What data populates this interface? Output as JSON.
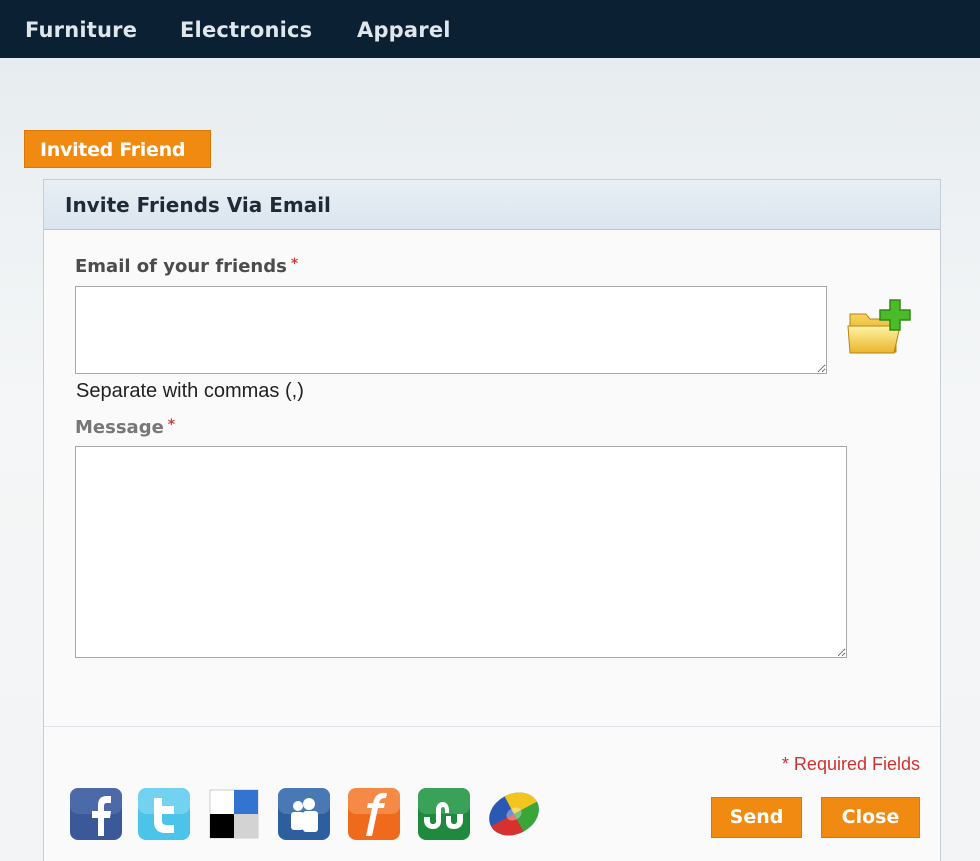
{
  "nav": {
    "items": [
      {
        "label": "Furniture"
      },
      {
        "label": "Electronics"
      },
      {
        "label": "Apparel"
      }
    ]
  },
  "tab": {
    "label": "Invited Friend"
  },
  "panel": {
    "title": "Invite Friends Via Email"
  },
  "form": {
    "email_label": "Email of your friends",
    "email_value": "",
    "email_hint": "Separate with commas (,)",
    "message_label": "Message",
    "message_value": "",
    "required_star": "*",
    "required_note": "* Required Fields"
  },
  "buttons": {
    "send": "Send",
    "close": "Close"
  },
  "social_icons": [
    "facebook-icon",
    "twitter-icon",
    "delicious-icon",
    "myspace-icon",
    "fark-icon",
    "stumbleupon-icon",
    "share-icon"
  ],
  "colors": {
    "accent": "#f08a10",
    "nav_bg": "#0b2033",
    "required": "#d93a3a"
  }
}
